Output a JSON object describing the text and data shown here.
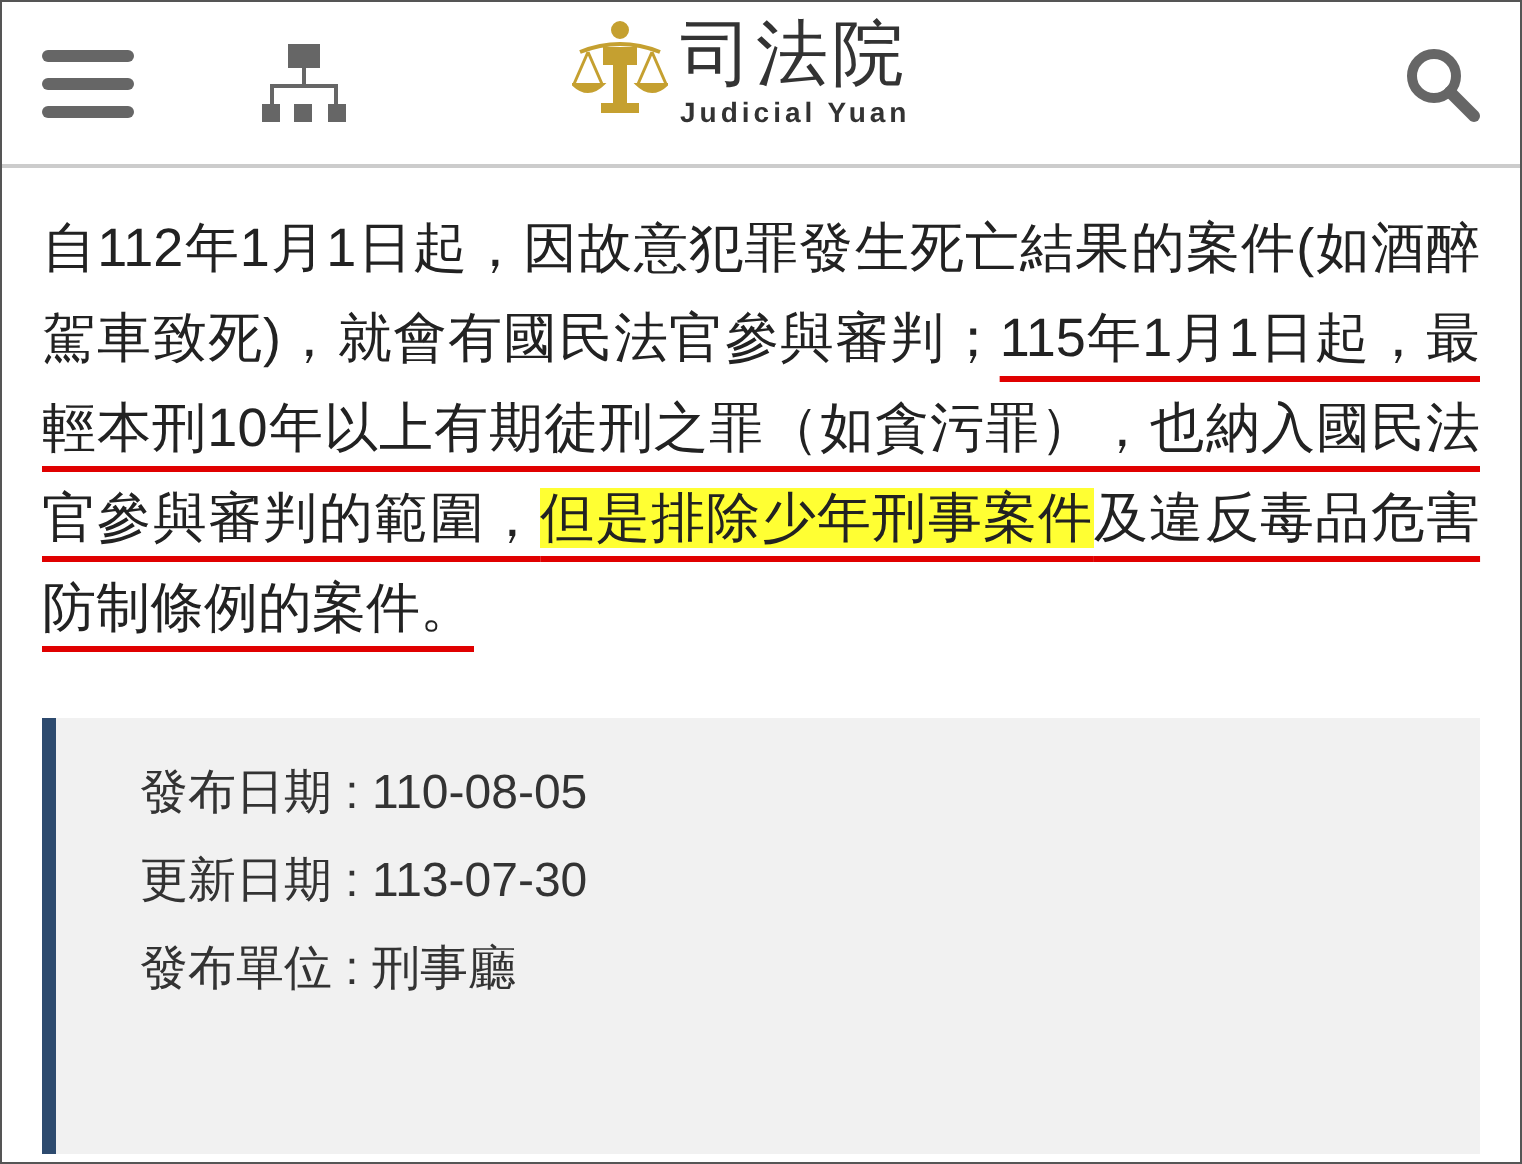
{
  "header": {
    "logo_title": "司法院",
    "logo_subtitle": "Judicial Yuan"
  },
  "paragraph": [
    {
      "text": "自112年1月1日起，因故意犯罪發生死亡結果的案件(如酒醉駕車致死)，就會有國民法官參與審判；",
      "underlined": false,
      "highlighted": false
    },
    {
      "text": "115年1月1日起，最輕本刑10年以上有期徒刑之罪（如貪污罪），也納入國民法官參與審判的範圍，",
      "underlined": true,
      "highlighted": false
    },
    {
      "text": "但是排除少年刑事案件",
      "underlined": true,
      "highlighted": true
    },
    {
      "text": "及違反毒品危害防制條例的案件。",
      "underlined": true,
      "highlighted": false
    }
  ],
  "info": [
    "發布日期 : 110-08-05",
    "更新日期 : 113-07-30",
    "發布單位 : 刑事廳"
  ]
}
